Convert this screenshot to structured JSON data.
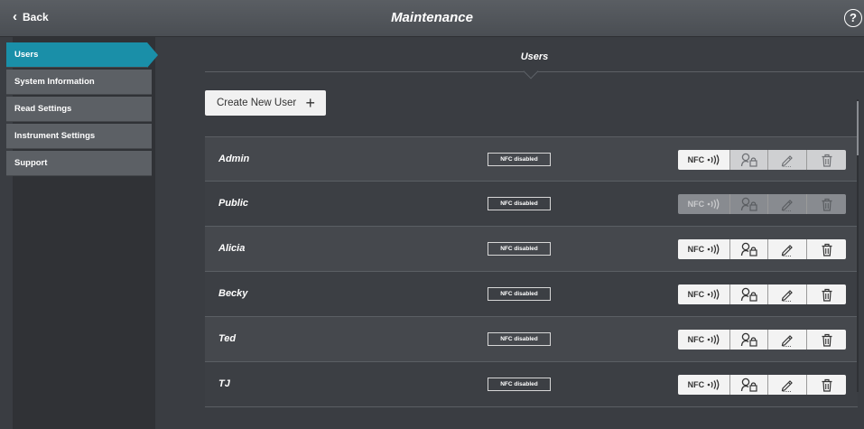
{
  "header": {
    "back_label": "Back",
    "title": "Maintenance",
    "help_label": "?"
  },
  "sidebar": {
    "items": [
      {
        "label": "Users",
        "active": true
      },
      {
        "label": "System Information",
        "active": false
      },
      {
        "label": "Read Settings",
        "active": false
      },
      {
        "label": "Instrument Settings",
        "active": false
      },
      {
        "label": "Support",
        "active": false
      }
    ]
  },
  "main": {
    "section_title": "Users",
    "create_button_label": "Create New User",
    "create_icon": "plus-icon",
    "users": [
      {
        "name": "Admin",
        "nfc_status": "NFC disabled",
        "nfc_button": "NFC",
        "state": "partial"
      },
      {
        "name": "Public",
        "nfc_status": "NFC disabled",
        "nfc_button": "NFC",
        "state": "disabled"
      },
      {
        "name": "Alicia",
        "nfc_status": "NFC disabled",
        "nfc_button": "NFC",
        "state": "enabled"
      },
      {
        "name": "Becky",
        "nfc_status": "NFC disabled",
        "nfc_button": "NFC",
        "state": "enabled"
      },
      {
        "name": "Ted",
        "nfc_status": "NFC disabled",
        "nfc_button": "NFC",
        "state": "enabled"
      },
      {
        "name": "TJ",
        "nfc_status": "NFC disabled",
        "nfc_button": "NFC",
        "state": "enabled"
      }
    ],
    "action_icons": [
      "nfc-icon",
      "user-lock-icon",
      "pencil-icon",
      "trash-icon"
    ]
  },
  "colors": {
    "accent": "#1a8fa8",
    "background": "#3a3d42",
    "sidebar": "#5c6065"
  }
}
